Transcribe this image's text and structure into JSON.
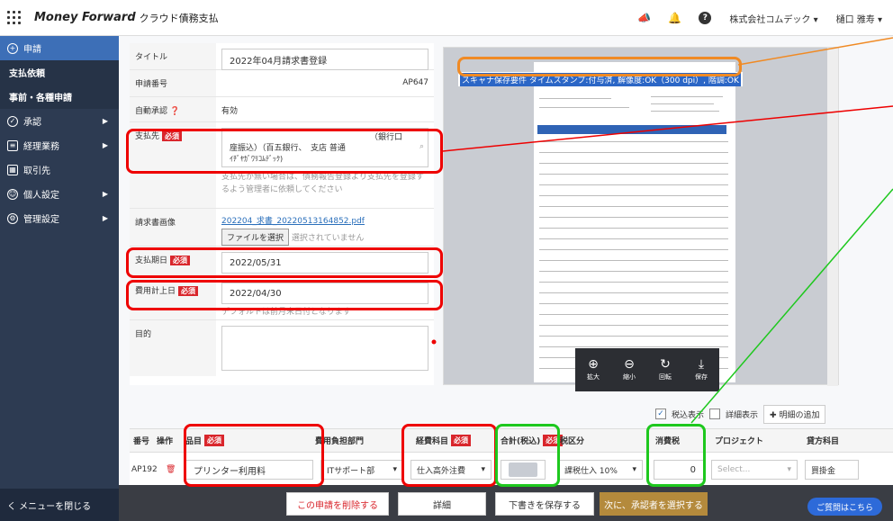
{
  "header": {
    "brand": "Money Forward",
    "product": "クラウド債務支払",
    "company": "株式会社コムデック",
    "user": "樋口 雅寿"
  },
  "sidebar": {
    "apply": "申請",
    "pay_request": "支払依頼",
    "pre_request": "事前・各種申請",
    "approval": "承認",
    "accounting": "経理業務",
    "vendors": "取引先",
    "personal": "個人設定",
    "admin": "管理設定",
    "close_menu": "く メニューを閉じる"
  },
  "form": {
    "title_label": "タイトル",
    "title_value": "2022年04月請求書登録",
    "number_label": "申請番号",
    "number_value": "AP647",
    "auto_label": "自動承認",
    "auto_value": "有効",
    "payee_label": "支払先",
    "required": "必須",
    "payee_line1": "（銀行口",
    "payee_line2": "座振込）（百五銀行、　支店 普通",
    "payee_line3": "ｲﾁﾞﾔｶﾞﾜﾘｺﾑﾃﾞｯｸ)",
    "payee_hint": "支払先が無い場合は、債務報告登録より支払先を登録するよう管理者に依頼してください",
    "invoice_label": "請求書画像",
    "invoice_file": "202204_求書_20220513164852.pdf",
    "file_button": "ファイルを選択",
    "file_none": "選択されていません",
    "due_label": "支払期日",
    "due_value": "2022/05/31",
    "expense_label": "費用計上日",
    "expense_value": "2022/04/30",
    "expense_hint": "デフォルトは前月末日付となります",
    "purpose_label": "目的"
  },
  "preview": {
    "scan_banner": "スキャナ保存要件 タイムスタンプ:付与済, 解像度:OK（300 dpi）, 階調:OK",
    "zoom_in": "拡大",
    "zoom_out": "縮小",
    "rotate": "回転",
    "save": "保存"
  },
  "controls": {
    "tax_included": "税込表示",
    "detail_view": "詳細表示",
    "add_detail": "明細の追加"
  },
  "table": {
    "headers": {
      "no": "番号",
      "op": "操作",
      "item": "品目",
      "dept": "費用負担部門",
      "account": "経費科目",
      "total": "合計(税込)",
      "tax_class": "税区分",
      "tax": "消費税",
      "project": "プロジェクト",
      "credit": "貸方科目"
    },
    "row": {
      "no": "AP192",
      "item": "プリンター利用料",
      "dept": "ITサポート部",
      "account": "仕入高外注費",
      "tax_class": "課税仕入 10%",
      "tax": "0",
      "project": "Select...",
      "credit": "買掛金"
    }
  },
  "footer": {
    "delete": "この申請を削除する",
    "detail": "詳細",
    "save_draft": "下書きを保存する",
    "next": "次に、承認者を選択する",
    "help": "ご質問はこちら"
  }
}
